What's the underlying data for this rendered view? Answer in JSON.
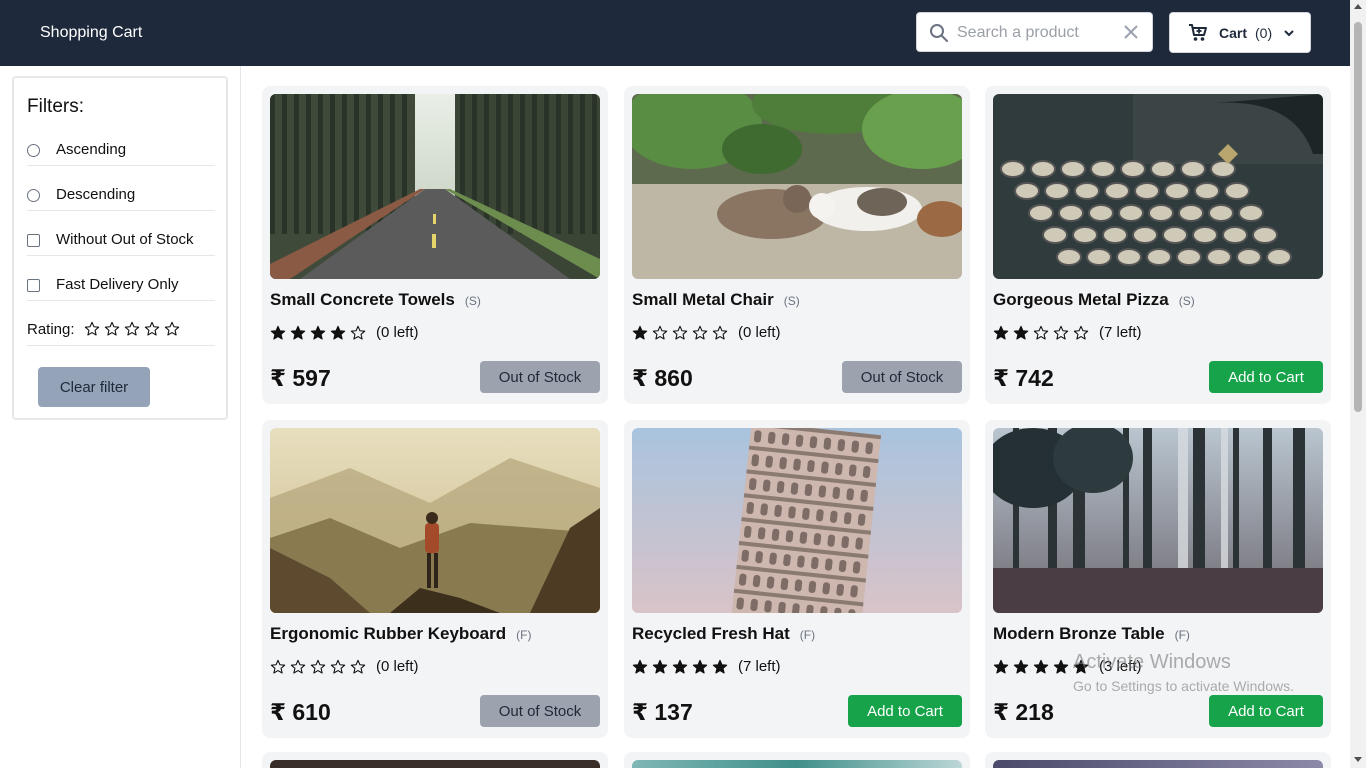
{
  "header": {
    "brand": "Shopping Cart",
    "search_placeholder": "Search a product",
    "cart_label": "Cart",
    "cart_count": "(0)"
  },
  "filters": {
    "title": "Filters:",
    "options": [
      "Ascending",
      "Descending",
      "Without Out of Stock",
      "Fast Delivery Only"
    ],
    "rating_label": "Rating:",
    "rating_value": 0,
    "clear_label": "Clear filter"
  },
  "products": [
    {
      "name": "Small Concrete Towels",
      "tag": "(S)",
      "rating": 4,
      "stock": "(0 left)",
      "price": "₹ 597",
      "button": "Out of Stock",
      "image": "forest-road"
    },
    {
      "name": "Small Metal Chair",
      "tag": "(S)",
      "rating": 1,
      "stock": "(0 left)",
      "price": "₹ 860",
      "button": "Out of Stock",
      "image": "cats-under-leaves"
    },
    {
      "name": "Gorgeous Metal Pizza",
      "tag": "(S)",
      "rating": 2,
      "stock": "(7 left)",
      "price": "₹ 742",
      "button": "Add to Cart",
      "image": "typewriter"
    },
    {
      "name": "Ergonomic Rubber Keyboard",
      "tag": "(F)",
      "rating": 0,
      "stock": "(0 left)",
      "price": "₹ 610",
      "button": "Out of Stock",
      "image": "hiker-mountains"
    },
    {
      "name": "Recycled Fresh Hat",
      "tag": "(F)",
      "rating": 5,
      "stock": "(7 left)",
      "price": "₹ 137",
      "button": "Add to Cart",
      "image": "leaning-tower"
    },
    {
      "name": "Modern Bronze Table",
      "tag": "(F)",
      "rating": 5,
      "stock": "(3 left)",
      "price": "₹ 218",
      "button": "Add to Cart",
      "image": "misty-forest"
    }
  ],
  "watermark": {
    "line1": "Activate Windows",
    "line2": "Go to Settings to activate Windows."
  },
  "colors": {
    "header_bg": "#1e293b",
    "add_button": "#16a34a",
    "oos_button": "#9ca3af",
    "clear_button": "#94a3b8",
    "card_bg": "#f3f4f6"
  }
}
